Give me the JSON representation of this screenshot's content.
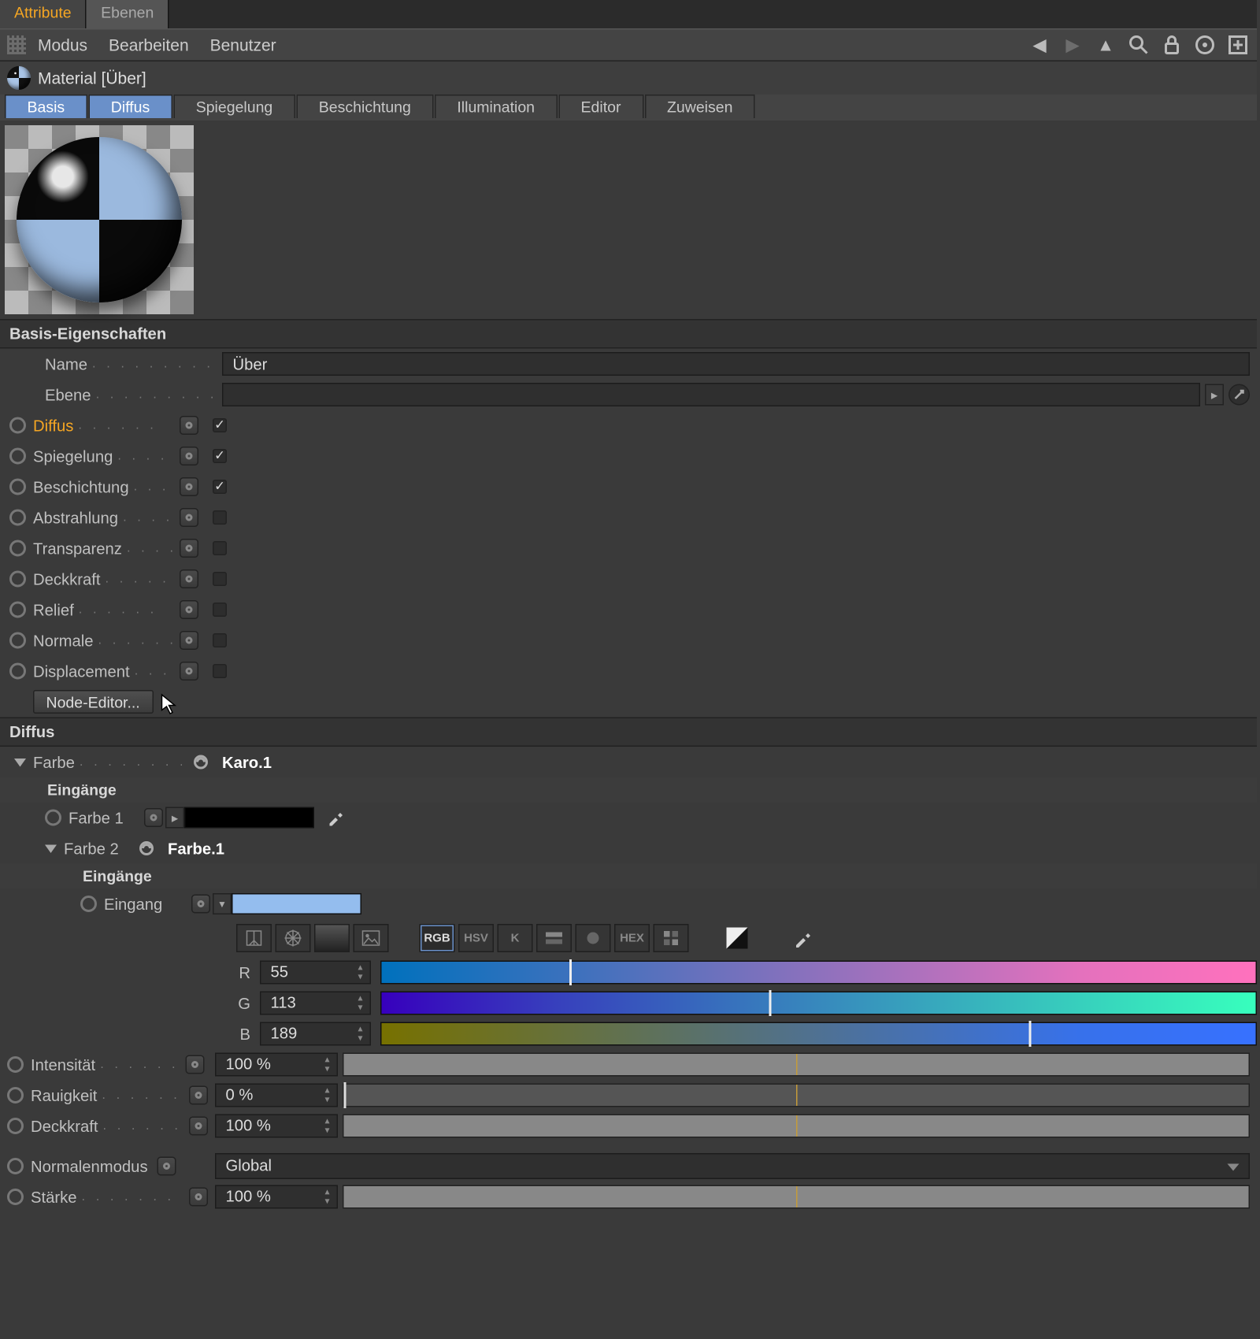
{
  "top_tabs": {
    "attribute": "Attribute",
    "layers": "Ebenen"
  },
  "menubar": {
    "mode": "Modus",
    "edit": "Bearbeiten",
    "user": "Benutzer"
  },
  "material_header": "Material [Über]",
  "channel_tabs": {
    "basis": "Basis",
    "diffus": "Diffus",
    "spiegelung": "Spiegelung",
    "beschichtung": "Beschichtung",
    "illumination": "Illumination",
    "editor": "Editor",
    "zuweisen": "Zuweisen"
  },
  "basis_section": "Basis-Eigenschaften",
  "basis": {
    "name_label": "Name",
    "name_value": "Über",
    "ebene_label": "Ebene",
    "ebene_value": "",
    "channels": [
      {
        "label": "Diffus",
        "checked": true,
        "hi": true
      },
      {
        "label": "Spiegelung",
        "checked": true,
        "hi": false
      },
      {
        "label": "Beschichtung",
        "checked": true,
        "hi": false
      },
      {
        "label": "Abstrahlung",
        "checked": false,
        "hi": false
      },
      {
        "label": "Transparenz",
        "checked": false,
        "hi": false
      },
      {
        "label": "Deckkraft",
        "checked": false,
        "hi": false
      },
      {
        "label": "Relief",
        "checked": false,
        "hi": false
      },
      {
        "label": "Normale",
        "checked": false,
        "hi": false
      },
      {
        "label": "Displacement",
        "checked": false,
        "hi": false
      }
    ],
    "node_editor": "Node-Editor..."
  },
  "diffus_section": "Diffus",
  "diffus": {
    "farbe_label": "Farbe",
    "farbe_link": "Karo.1",
    "eingaenge": "Eingänge",
    "farbe1_label": "Farbe 1",
    "farbe2_label": "Farbe 2",
    "farbe2_link": "Farbe.1",
    "eingang_label": "Eingang",
    "mode_buttons": [
      "brightness",
      "wheel",
      "spectrum",
      "image",
      "",
      "RGB",
      "HSV",
      "K",
      "mixer",
      "swatch",
      "HEX",
      "alpha",
      "",
      "contrast",
      "",
      "picker"
    ],
    "rgb": {
      "r_label": "R",
      "r_value": "55",
      "g_label": "G",
      "g_value": "113",
      "b_label": "B",
      "b_value": "189"
    },
    "intensitaet_label": "Intensität",
    "intensitaet_value": "100 %",
    "rauigkeit_label": "Rauigkeit",
    "rauigkeit_value": "0 %",
    "deckkraft_label": "Deckkraft",
    "deckkraft_value": "100 %",
    "normalenmodus_label": "Normalenmodus",
    "normalenmodus_value": "Global",
    "staerke_label": "Stärke",
    "staerke_value": "100 %"
  }
}
